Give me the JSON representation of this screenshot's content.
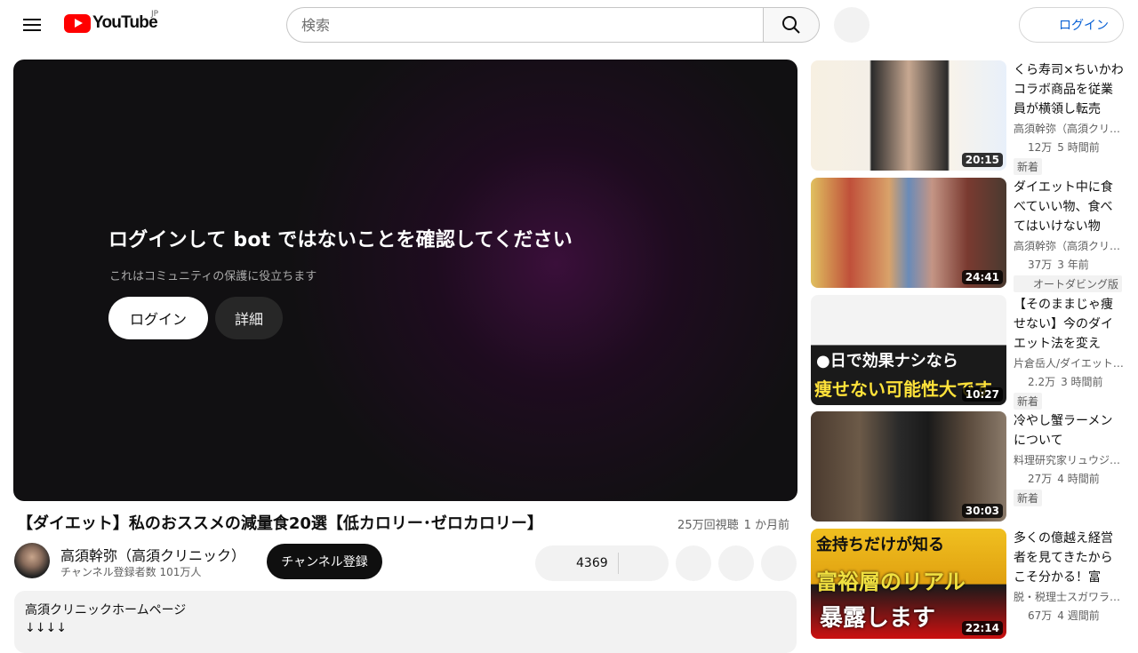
{
  "header": {
    "logo_text": "YouTube",
    "region": "JP",
    "search_placeholder": "検索",
    "login_label": "ログイン"
  },
  "player": {
    "title": "ログインして bot ではないことを確認してください",
    "subtitle": "これはコミュニティの保護に役立ちます",
    "login_label": "ログイン",
    "details_label": "詳細"
  },
  "video": {
    "title": "【ダイエット】私のおススメの減量食20選【低カロリー･ゼロカロリー】",
    "views": "25万回視聴",
    "age": "1 か月前"
  },
  "channel": {
    "name": "高須幹弥（高須クリニック）",
    "subscribers": "チャンネル登録者数 101万人",
    "subscribe_label": "チャンネル登録",
    "like_count": "4369"
  },
  "description": {
    "line1": "高須クリニックホームページ",
    "line2": "↓↓↓↓"
  },
  "recommendations": [
    {
      "title": "くら寿司×ちいかわコラボ商品を従業員が横領し転売し…",
      "channel": "高須幹弥（高須クリ…",
      "views": "12万",
      "age": "5 時間前",
      "badge": "新着",
      "duration": "20:15"
    },
    {
      "title": "ダイエット中に食べていい物、食べてはいけない物を…",
      "channel": "高須幹弥（高須クリ…",
      "views": "37万",
      "age": "3 年前",
      "badge": "オートダビング版",
      "duration": "24:41"
    },
    {
      "title": "【そのままじゃ痩せない】今のダイエット法を変えた…",
      "channel": "片倉岳人/ダイエット…",
      "views": "2.2万",
      "age": "3 時間前",
      "badge": "新着",
      "duration": "10:27",
      "thumb_text1": "●日で効果ナシなら",
      "thumb_text2": "痩せない可能性大です"
    },
    {
      "title": "冷やし蟹ラーメンについて",
      "channel": "料理研究家リュウジ…",
      "views": "27万",
      "age": "4 時間前",
      "badge": "新着",
      "duration": "30:03"
    },
    {
      "title": "多くの億越え経営者を見てきたからこそ分かる！富裕…",
      "channel": "脱・税理士スガワラ…",
      "views": "67万",
      "age": "4 週間前",
      "duration": "22:14",
      "thumb_text1": "金持ちだけが知る",
      "thumb_text2": "富裕層のリアル",
      "thumb_text3": "暴露します"
    }
  ]
}
